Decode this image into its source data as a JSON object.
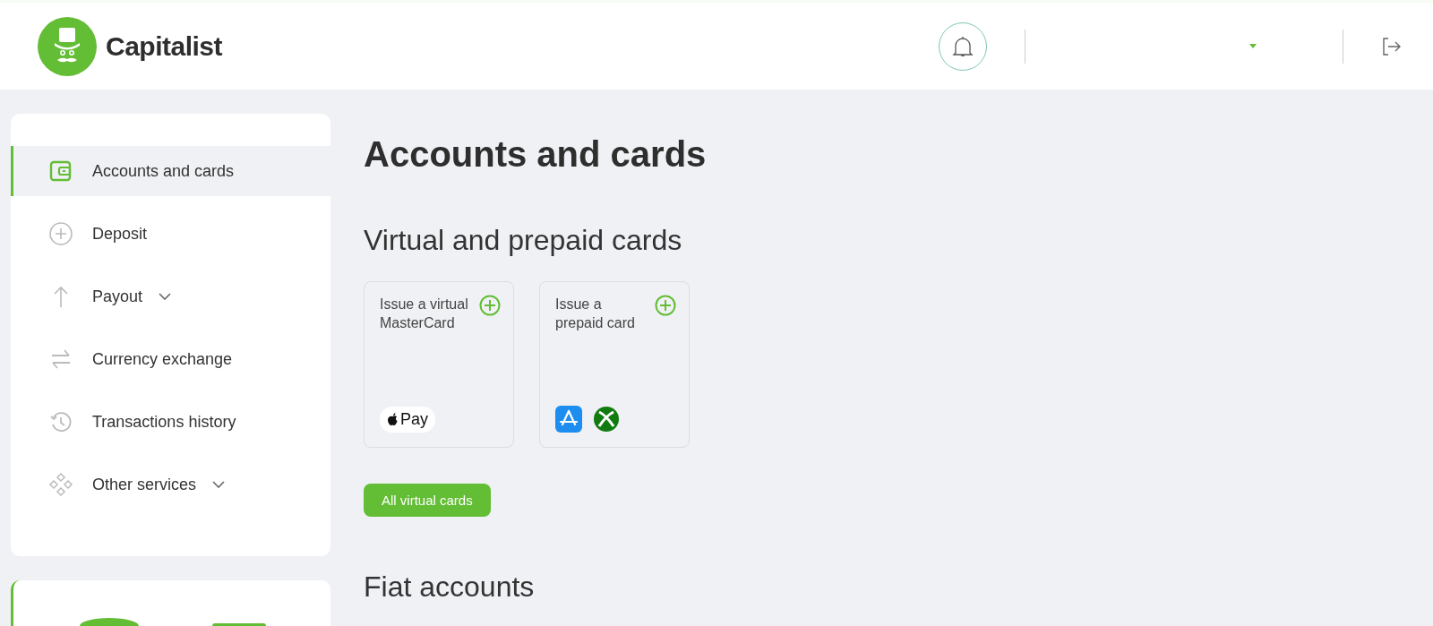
{
  "header": {
    "brand": "Capitalist"
  },
  "sidebar": {
    "items": [
      {
        "label": "Accounts and cards",
        "selected": true,
        "submenu": false
      },
      {
        "label": "Deposit",
        "selected": false,
        "submenu": false
      },
      {
        "label": "Payout",
        "selected": false,
        "submenu": true
      },
      {
        "label": "Currency exchange",
        "selected": false,
        "submenu": false
      },
      {
        "label": "Transactions history",
        "selected": false,
        "submenu": false
      },
      {
        "label": "Other services",
        "selected": false,
        "submenu": true
      }
    ]
  },
  "main": {
    "title": "Accounts and cards",
    "section": "Virtual and prepaid cards",
    "cards": [
      {
        "title": "Issue a virtual MasterCard",
        "badges": [
          {
            "kind": "apple-pay",
            "text": "Pay"
          }
        ]
      },
      {
        "title": "Issue a prepaid card",
        "badges": [
          {
            "kind": "app-store"
          },
          {
            "kind": "xbox"
          }
        ]
      }
    ],
    "all_button": "All virtual cards",
    "section_2": "Fiat accounts"
  }
}
